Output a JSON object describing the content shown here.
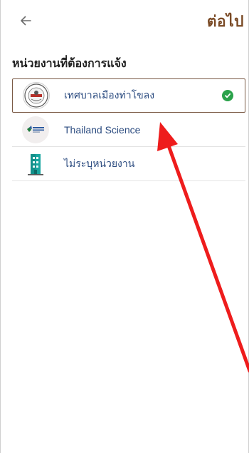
{
  "header": {
    "back_icon": "arrow-left-icon",
    "next_label": "ต่อไป"
  },
  "section": {
    "title": "หน่วยงานที่ต้องการแจ้ง"
  },
  "organizations": [
    {
      "label": "เทศบาลเมืองท่าโขลง",
      "icon": "municipality-seal-logo",
      "selected": true
    },
    {
      "label": "Thailand Science",
      "icon": "thailand-science-park-logo",
      "selected": false
    },
    {
      "label": "ไม่ระบุหน่วยงาน",
      "icon": "building-icon",
      "selected": false
    }
  ],
  "colors": {
    "accent": "#7a4a25",
    "label": "#2c4c80",
    "check": "#2aa24a",
    "arrow": "#ee1c1c"
  }
}
